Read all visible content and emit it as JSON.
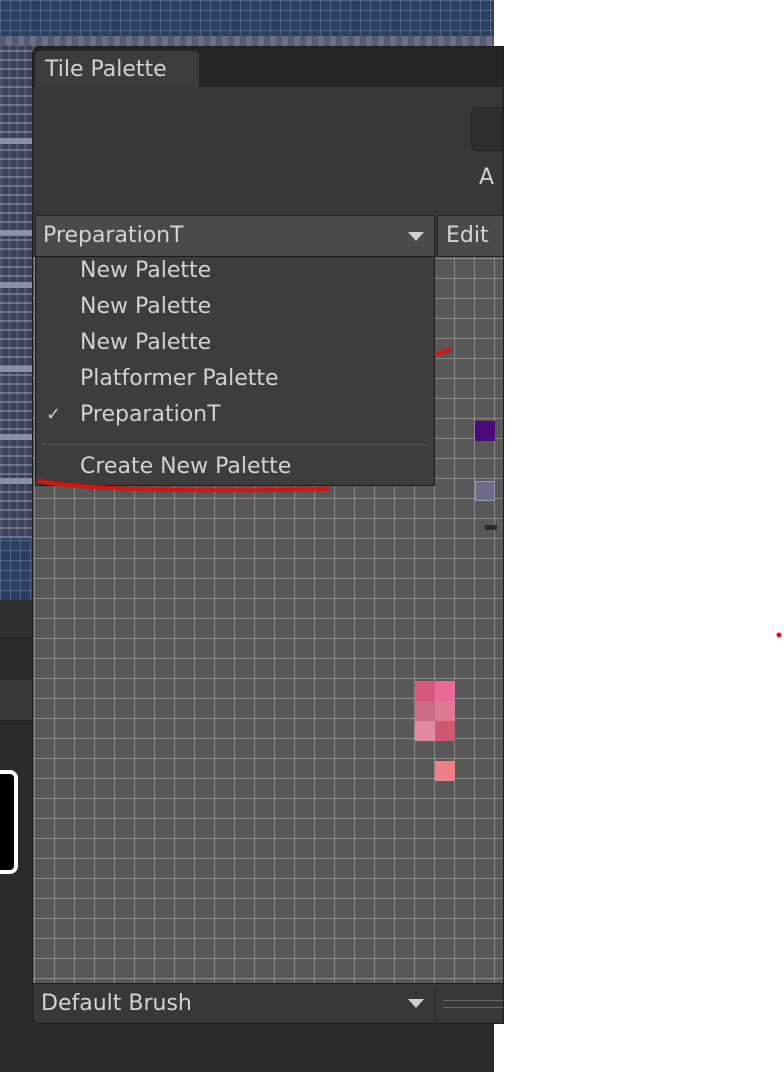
{
  "window": {
    "tab_title": "Tile Palette",
    "active_target_label": "A",
    "edit_label": "Edit"
  },
  "palette_selector": {
    "selected": "PreparationT",
    "caret_icon": "triangle-down-icon"
  },
  "palette_menu": {
    "items": [
      {
        "label": "New Palette",
        "checked": false
      },
      {
        "label": "New Palette",
        "checked": false
      },
      {
        "label": "New Palette",
        "checked": false
      },
      {
        "label": "Platformer Palette",
        "checked": false
      },
      {
        "label": "PreparationT",
        "checked": true
      }
    ],
    "check_symbol": "✓",
    "create_label": "Create New Palette"
  },
  "brush": {
    "selected": "Default Brush"
  },
  "colors": {
    "window_bg": "#383838",
    "grid_bg": "#585858",
    "annotation": "#e01010",
    "tile_purple": "#4a0a7a",
    "tile_pink": "#e06a8a"
  }
}
